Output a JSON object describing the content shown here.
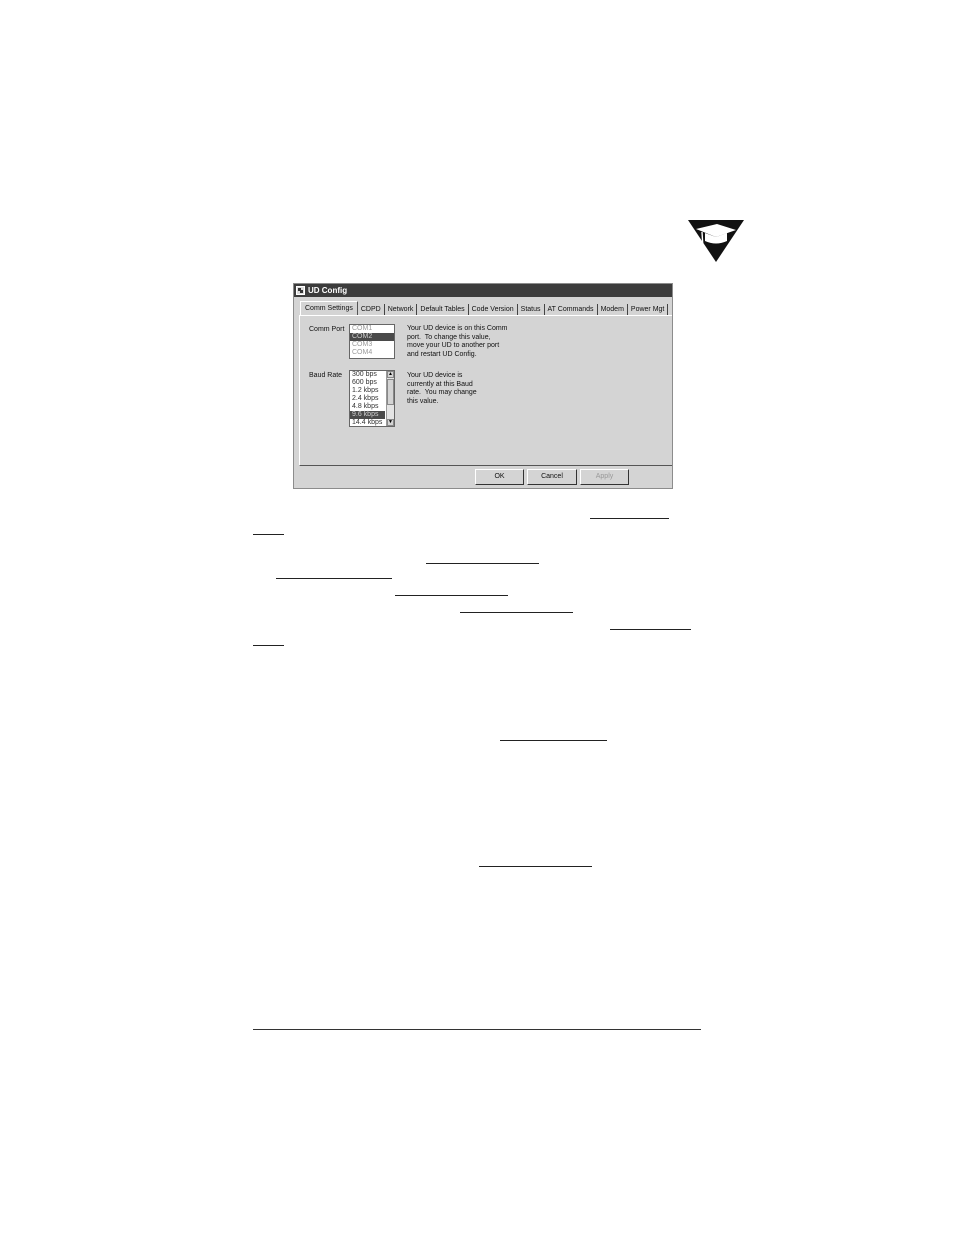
{
  "dialog": {
    "title": "UD Config",
    "tabs": [
      {
        "label": "Comm Settings",
        "active": true
      },
      {
        "label": "CDPD"
      },
      {
        "label": "Network"
      },
      {
        "label": "Default Tables"
      },
      {
        "label": "Code Version"
      },
      {
        "label": "Status"
      },
      {
        "label": "AT Commands"
      },
      {
        "label": "Modem"
      },
      {
        "label": "Power Mgt"
      }
    ],
    "comm_port": {
      "label": "Comm Port",
      "options": [
        "COM1",
        "COM2",
        "COM3",
        "COM4"
      ],
      "selected": "COM2",
      "description": [
        "Your UD device is on this Comm",
        "port.  To change this value,",
        "move your UD to another port",
        "and restart UD Config."
      ]
    },
    "baud_rate": {
      "label": "Baud Rate",
      "options": [
        "300 bps",
        "600 bps",
        "1.2 kbps",
        "2.4 kbps",
        "4.8 kbps",
        "9.6 kbps",
        "14.4 kbps"
      ],
      "selected": "9.6 kbps",
      "description": [
        "Your UD device is",
        "currently at this Baud",
        "rate.  You may change",
        "this value."
      ]
    },
    "buttons": {
      "ok": "OK",
      "cancel": "Cancel",
      "apply": "Apply"
    }
  },
  "icons": {
    "badge": "graduation-cap-icon"
  },
  "colors": {
    "titlebar": "#3c3c3c",
    "dialog_bg": "#d4d4d4",
    "selection": "#4a4a4a"
  }
}
